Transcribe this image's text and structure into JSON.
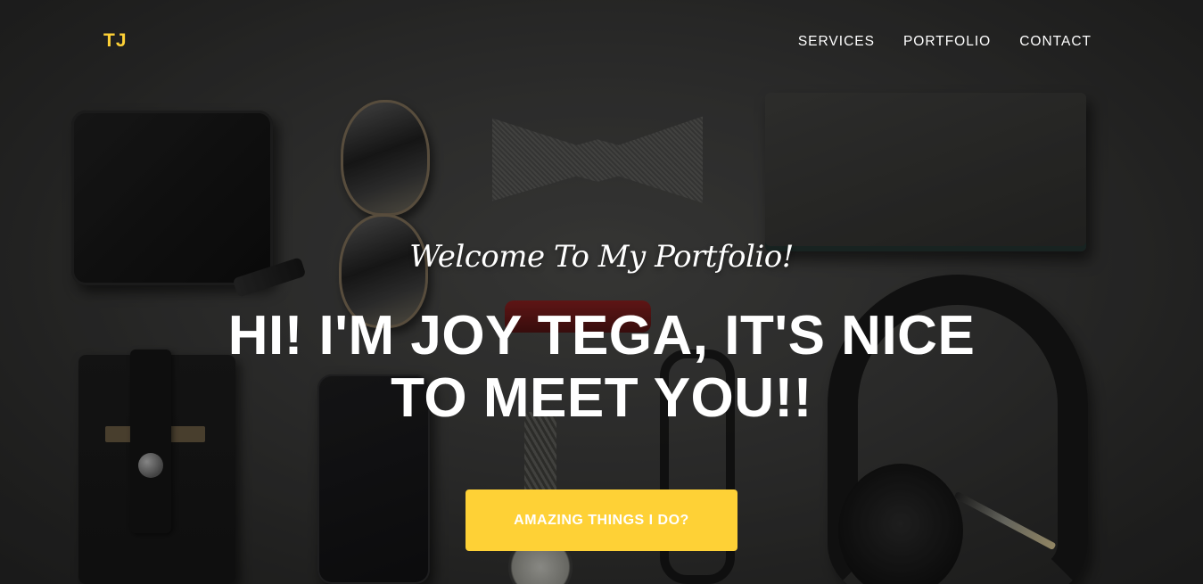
{
  "nav": {
    "brand": "TJ",
    "links": [
      {
        "label": "SERVICES"
      },
      {
        "label": "PORTFOLIO"
      },
      {
        "label": "CONTACT"
      }
    ]
  },
  "hero": {
    "lead": "Welcome To My Portfolio!",
    "heading_line1": "HI! I'M JOY TEGA, IT'S NICE",
    "heading_line2": "TO MEET YOU!!",
    "cta_label": "AMAZING THINGS I DO?"
  },
  "colors": {
    "accent": "#fed136",
    "text": "#ffffff",
    "background": "#2e2e2d"
  }
}
